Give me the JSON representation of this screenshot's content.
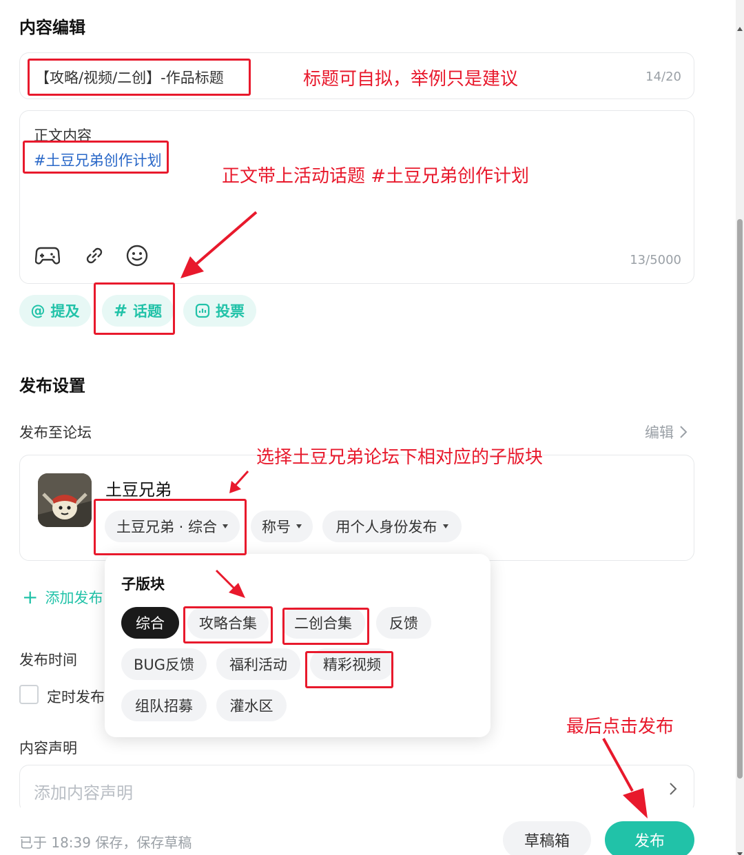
{
  "content_editing": {
    "section_title": "内容编辑",
    "title_input": {
      "value": "【攻略/视频/二创】-作品标题",
      "counter": "14/20"
    },
    "body": {
      "line1": "正文内容",
      "topic": "#土豆兄弟创作计划",
      "counter": "13/5000",
      "toolbar_icons": [
        "game-controller-icon",
        "link-icon",
        "emoji-icon"
      ]
    },
    "actions": {
      "mention": "提及",
      "topic": "话题",
      "vote": "投票"
    }
  },
  "publish_settings": {
    "section_title": "发布设置",
    "forum_label": "发布至论坛",
    "edit_label": "编辑",
    "forum": {
      "name": "土豆兄弟",
      "subforum_select": "土豆兄弟 · 综合",
      "title_select": "称号",
      "identity_select": "用个人身份发布"
    },
    "add_publish": "添加发布",
    "time_label": "发布时间",
    "scheduled_label": "定时发布",
    "statement_label": "内容声明",
    "statement_placeholder": "添加内容声明"
  },
  "subforum_dropdown": {
    "title": "子版块",
    "options": [
      "综合",
      "攻略合集",
      "二创合集",
      "反馈",
      "BUG反馈",
      "福利活动",
      "精彩视频",
      "组队招募",
      "灌水区"
    ],
    "selected": "综合"
  },
  "footer": {
    "save_status": "已于 18:39 保存，保存草稿",
    "drafts_button": "草稿箱",
    "publish_button": "发布"
  },
  "annotations": {
    "title_note": "标题可自拟，举例只是建议",
    "topic_note": "正文带上活动话题 #土豆兄弟创作计划",
    "subforum_note": "选择土豆兄弟论坛下相对应的子版块",
    "publish_note": "最后点击发布"
  },
  "colors": {
    "accent": "#21c2a8",
    "annotation_red": "#e8192c",
    "selected_tag": "#1a1a1a"
  }
}
